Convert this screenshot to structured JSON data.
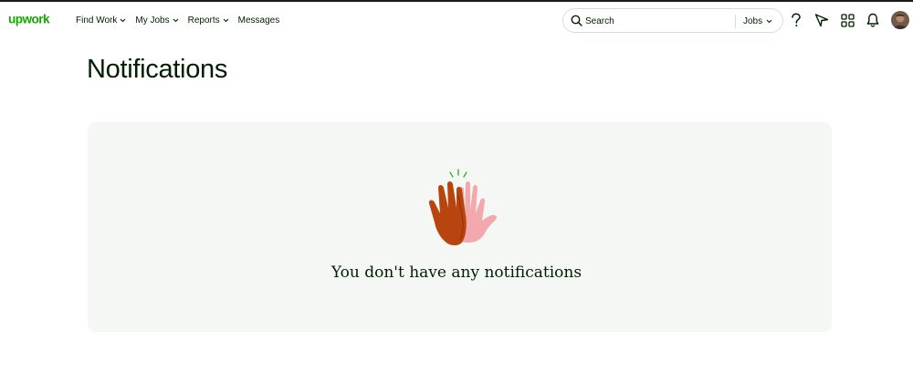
{
  "brand": {
    "logo_text": "upwork",
    "color": "#14a800"
  },
  "nav": {
    "items": [
      {
        "label": "Find Work",
        "has_dropdown": true
      },
      {
        "label": "My Jobs",
        "has_dropdown": true
      },
      {
        "label": "Reports",
        "has_dropdown": true
      },
      {
        "label": "Messages",
        "has_dropdown": false
      }
    ]
  },
  "search": {
    "placeholder": "Search",
    "filter_label": "Jobs",
    "icon": "search-icon"
  },
  "header_icons": [
    "help-icon",
    "send-icon",
    "apps-grid-icon",
    "bell-icon"
  ],
  "page": {
    "title": "Notifications",
    "empty_message": "You don't have any notifications",
    "illustration": "high-five-illustration"
  },
  "colors": {
    "text": "#001e00",
    "card_bg": "#f5f7f5",
    "border": "#d5e0d5"
  }
}
